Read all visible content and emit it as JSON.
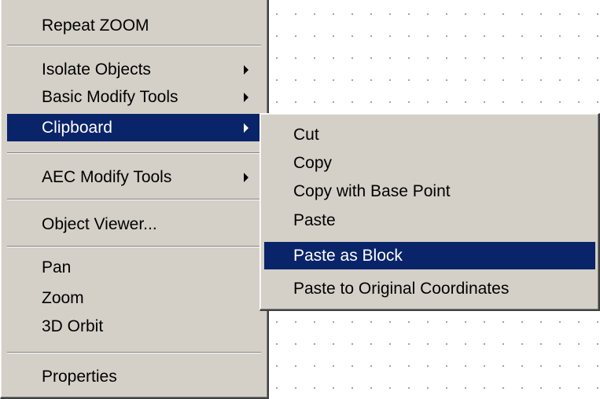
{
  "context_menu": {
    "repeat_zoom": "Repeat ZOOM",
    "isolate_objects": "Isolate Objects",
    "basic_modify_tools": "Basic Modify Tools",
    "clipboard": "Clipboard",
    "aec_modify_tools": "AEC Modify Tools",
    "object_viewer": "Object Viewer...",
    "pan": "Pan",
    "zoom": "Zoom",
    "orbit_3d": "3D Orbit",
    "properties": "Properties"
  },
  "clipboard_submenu": {
    "cut": "Cut",
    "copy": "Copy",
    "copy_with_base_point": "Copy with Base Point",
    "paste": "Paste",
    "paste_as_block": "Paste as Block",
    "paste_to_original_coordinates": "Paste to Original Coordinates"
  },
  "colors": {
    "menu_background": "#d4d0c8",
    "highlight": "#0a246a",
    "highlight_text": "#ffffff",
    "canvas_background": "#ffffff",
    "grid_dots": "#9a9a9a"
  },
  "icons": {
    "submenu_arrow": "submenu-arrow-icon"
  }
}
